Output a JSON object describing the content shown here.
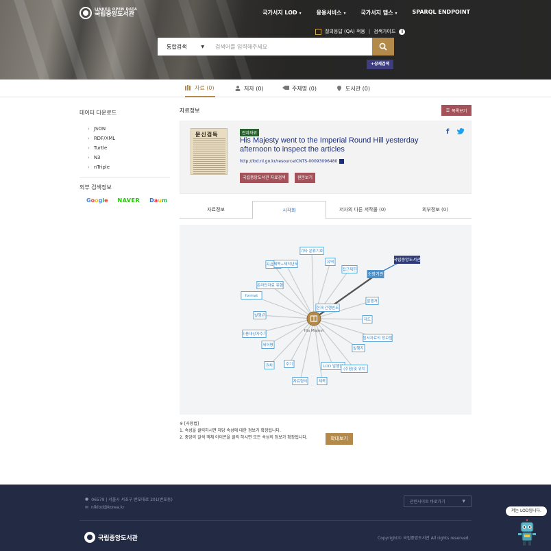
{
  "header": {
    "logo_small": "LINKED OPEN DATA",
    "logo_big": "국립중앙도서관",
    "nav": [
      "국가서지 LOD",
      "응용서비스",
      "국가서지 맵스",
      "SPARQL ENDPOINT"
    ],
    "qa_label": "질의응답 (QA) 적용",
    "guide_label": "검색가이드",
    "search_category": "통합검색",
    "search_placeholder": "검색어를 입력해주세요",
    "advanced_search": "+상세검색"
  },
  "tabs": [
    {
      "label": "자료 (0)"
    },
    {
      "label": "저자 (0)"
    },
    {
      "label": "주제명 (0)"
    },
    {
      "label": "도서관 (0)"
    }
  ],
  "sidebar": {
    "download_title": "데이터 다운로드",
    "formats": [
      "JSON",
      "RDF/XML",
      "Turtle",
      "N3",
      "nTriple"
    ],
    "external_title": "외부 검색정보",
    "portals": {
      "google": "Google",
      "naver": "NAVER",
      "daum": "Daum"
    }
  },
  "main": {
    "title": "자료정보",
    "list_button": "목록보기",
    "thumb_title": "문신검독",
    "badge": "전자자료",
    "record_title": "His Majesty went to the Imperial Round Hill yesterday afternoon to inspect the articles",
    "record_url": "http://lod.nl.go.kr/resource/CNTS-00093096480",
    "btn_library": "국립중앙도서관 자료검색",
    "btn_fulltext": "원문보기",
    "share_facebook": "f",
    "share_twitter": "t"
  },
  "subtabs": [
    "자료정보",
    "시각화",
    "저자의 다른 저작물 (0)",
    "외부정보 (0)"
  ],
  "graph": {
    "center_label": "His Majest",
    "center_tag": "현재 간행빈도",
    "selected": "소장기관",
    "selected_target": "국립중앙도서관",
    "nodes": [
      "기타 분류기호",
      "자료유형",
      "제목+제작년도",
      "유역",
      "접근제한",
      "온라인자료 유형",
      "format",
      "발행처",
      "발행년",
      "제도",
      "이용대상자주기",
      "원서자료의 정보원",
      "세어명",
      "발행지",
      "권차",
      "주기",
      "LOD 발행일",
      "(주형)및 위치",
      "자료형식",
      "제목"
    ]
  },
  "notes": {
    "heading": "※ [사용법]",
    "line1": "1. 속성을 클릭하시면 해당 속성에 대한 정보가 확장됩니다.",
    "line2": "2. 중앙의 갈색 객체 아이콘을 클릭 하시면 모든 속성의 정보가 확장됩니다.",
    "zoom_button": "확대보기"
  },
  "footer": {
    "address": "06579 | 서울시 서초구 반포대로 201(반포동)",
    "email": "nlklod@korea.kr",
    "site_select": "관련사이트 바로가기",
    "logo": "국립중앙도서관",
    "copyright": "Copyright© 국립중앙도서관 All rights reserved."
  },
  "chatbot": {
    "bubble": "저는 LOD입니다."
  },
  "colors": {
    "accent": "#b48a4a",
    "maroon": "#a4525a",
    "link": "#1a2d78",
    "footer": "#232a44",
    "node_border": "#4a9fd8"
  }
}
